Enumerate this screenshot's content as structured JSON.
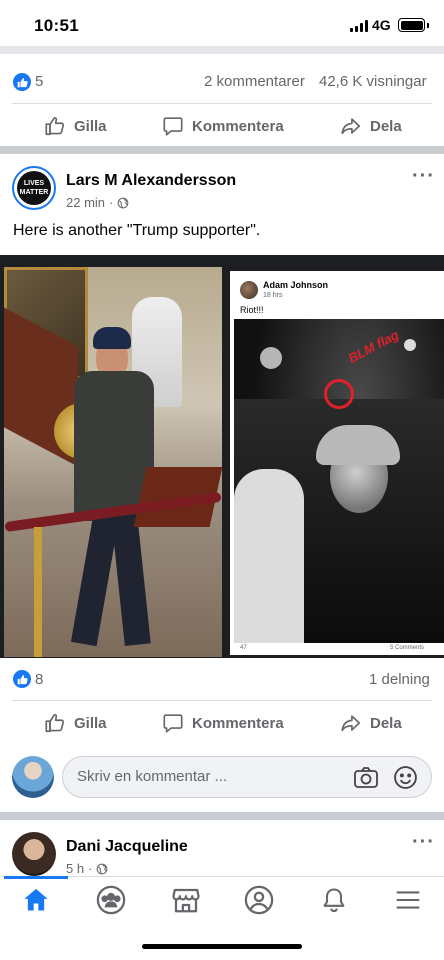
{
  "status_bar": {
    "time": "10:51",
    "network": "4G",
    "battery_level": 1.0
  },
  "post1": {
    "reactions_count": "5",
    "comments": "2 kommentarer",
    "views": "42,6 K visningar"
  },
  "actions": {
    "like": "Gilla",
    "comment": "Kommentera",
    "share": "Dela"
  },
  "post2": {
    "author": "Lars M Alexandersson",
    "avatar_text": "LIVES MATTER",
    "time": "22 min",
    "text": "Here is another \"Trump supporter\".",
    "shared_post": {
      "author": "Adam Johnson",
      "time": "18 hrs",
      "text": "Riot!!!",
      "annotation": "BLM flag",
      "reactions_count": "47",
      "comments": "5 Comments"
    },
    "reactions_count": "8",
    "shares": "1 delning"
  },
  "comment_input": {
    "placeholder": "Skriv en kommentar ..."
  },
  "post3": {
    "author": "Dani Jacqueline",
    "time": "5 h"
  },
  "colors": {
    "accent": "#1877f2",
    "secondary_text": "#65676b",
    "divider": "#c9ccd1",
    "annotation_red": "#e0202a"
  },
  "tabs": [
    "home-icon",
    "groups-icon",
    "marketplace-icon",
    "profile-icon",
    "notifications-icon",
    "menu-icon"
  ]
}
